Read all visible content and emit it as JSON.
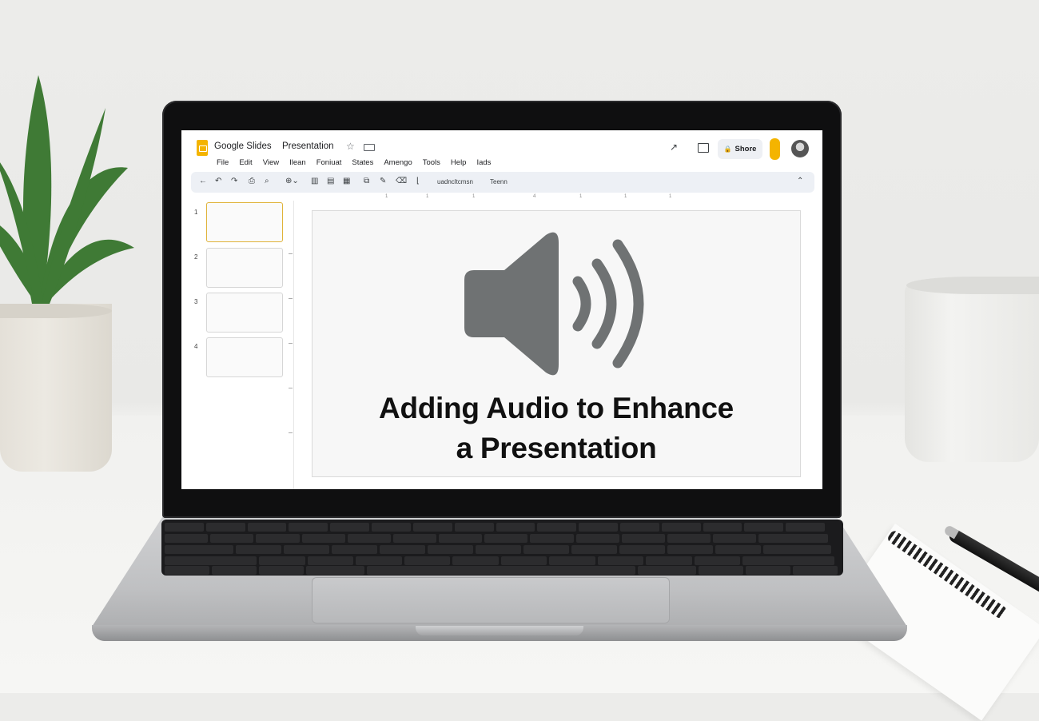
{
  "app": {
    "name": "Google Slides",
    "document_title": "Presentation",
    "menus": [
      "File",
      "Edit",
      "View",
      "Ilean",
      "Foniuat",
      "States",
      "Amengo",
      "Tools",
      "Help",
      "Iads"
    ],
    "share_label": "Shore"
  },
  "toolbar": {
    "text_items": [
      "uadncltcmsn",
      "Teenn"
    ]
  },
  "ruler": {
    "marks": [
      "1",
      "1",
      "1",
      "4",
      "1",
      "1",
      "1"
    ]
  },
  "filmstrip": {
    "slides": [
      {
        "number": "1",
        "selected": true
      },
      {
        "number": "2",
        "selected": false
      },
      {
        "number": "3",
        "selected": false
      },
      {
        "number": "4",
        "selected": false
      }
    ]
  },
  "slide": {
    "title_line1": "Adding Audio to Enhance",
    "title_line2": "a Presentation",
    "icon": "speaker-volume-icon"
  },
  "colors": {
    "accent": "#f4b400",
    "selected_border": "#e0b33a",
    "speaker_gray": "#6f7273"
  }
}
